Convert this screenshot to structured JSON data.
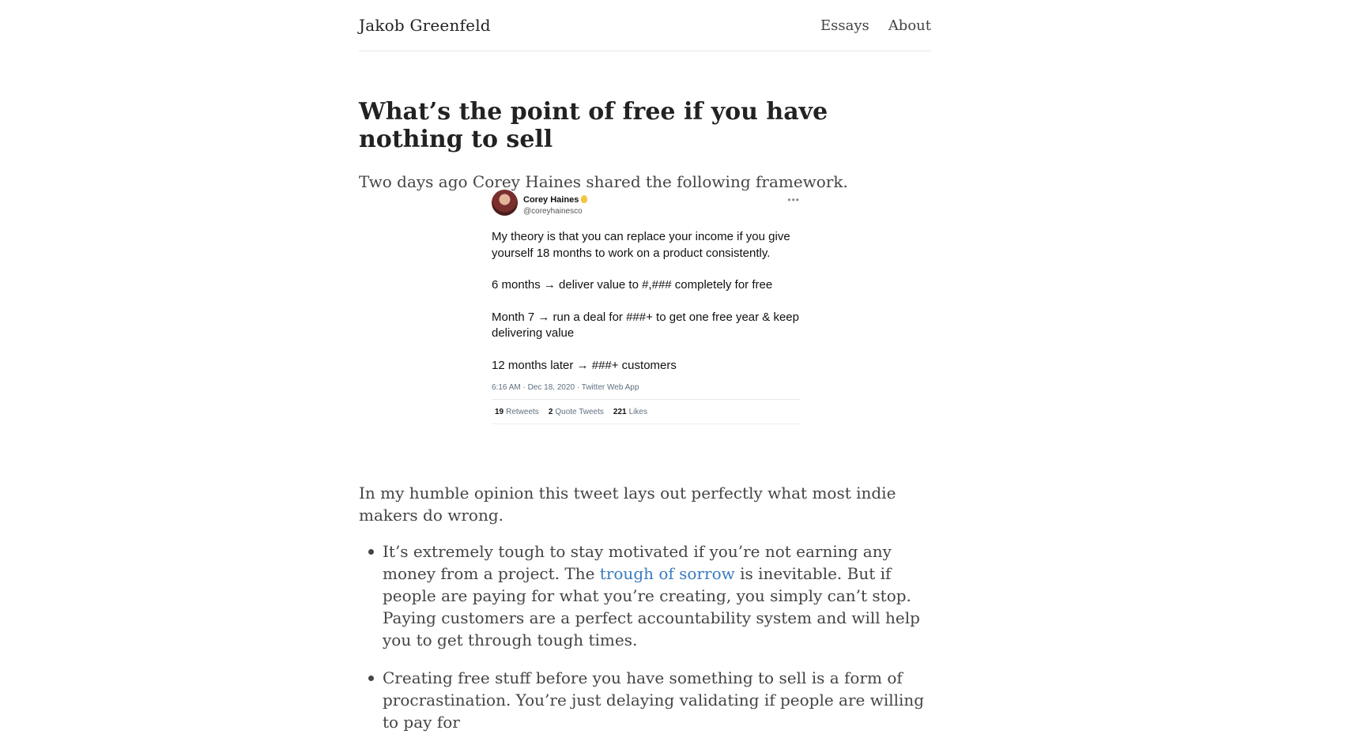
{
  "header": {
    "brand": "Jakob Greenfeld",
    "nav": {
      "essays": "Essays",
      "about": "About"
    }
  },
  "article": {
    "title": "What’s the point of free if you have nothing to sell",
    "intro": "Two days ago Corey Haines shared the following framework.",
    "after_tweet": "In my humble opinion this tweet lays out perfectly what most indie makers do wrong.",
    "bullets": [
      {
        "before": "It’s extremely tough to stay motivated if you’re not earning any money from a project. The ",
        "link": "trough of sorrow",
        "after": " is inevitable. But if people are paying for what you’re creating, you simply can’t stop. Paying customers are a perfect accountability system and will help you to get through tough times."
      },
      {
        "text": "Creating free stuff before you have something to sell is a form of procrastination. You’re just delaying validating if people are willing to pay for"
      }
    ]
  },
  "tweet": {
    "name": "Corey Haines",
    "handle": "@coreyhainesco",
    "more": "•••",
    "lines": [
      "My theory is that you can replace your income if you give yourself 18 months to work on a product consistently.",
      "",
      "6 months → deliver value to #,### completely for free",
      "",
      "Month 7 → run a deal for ###+ to get one free year & keep delivering value",
      "",
      "12 months later → ###+ customers"
    ],
    "timestamp": "6:16 AM · Dec 18, 2020 · Twitter Web App",
    "stats": {
      "retweets_count": "19",
      "retweets_label": "Retweets",
      "quotes_count": "2",
      "quotes_label": "Quote Tweets",
      "likes_count": "221",
      "likes_label": "Likes"
    }
  },
  "colors": {
    "link": "#3a7bbf",
    "text": "#444444",
    "heading": "#222222"
  }
}
